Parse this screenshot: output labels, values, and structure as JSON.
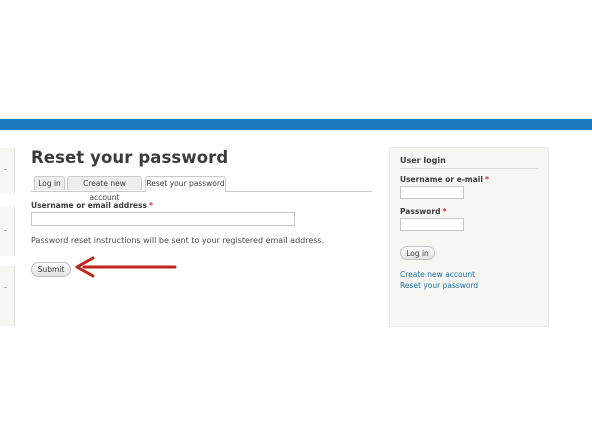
{
  "main": {
    "title": "Reset your password",
    "tabs": [
      {
        "label": "Log in"
      },
      {
        "label": "Create new account"
      },
      {
        "label": "Reset your password"
      }
    ],
    "username_field": {
      "label": "Username or email address",
      "required_marker": "*",
      "value": ""
    },
    "help_text": "Password reset instructions will be sent to your registered email address.",
    "submit_label": "Submit",
    "arrow_color": "#c0271c"
  },
  "sidebar": {
    "block_title": "User login",
    "username_label": "Username or e-mail",
    "password_label": "Password",
    "required_marker": "*",
    "login_label": "Log in",
    "links": [
      "Create new account",
      "Reset your password"
    ]
  },
  "colors": {
    "header_bar": "#1d7bbd",
    "link": "#1d6fa5",
    "required": "#d12d2d"
  }
}
